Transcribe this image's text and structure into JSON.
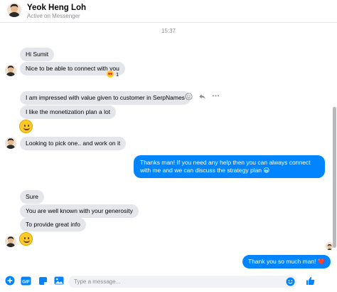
{
  "header": {
    "name": "Yeok Heng Loh",
    "status": "Active on Messenger"
  },
  "timestamp": "15:37",
  "messages": {
    "m1": "Hi Sumit",
    "m2": "Nice to be able to connect with you",
    "m2_reaction_count": "1",
    "m3": "I am impressed with value given to customer in SerpNames",
    "m4": "I like the monetization plan a lot",
    "m5": "Looking to pick one.. and work on it",
    "m6": "Thanks man! If you need any help then you can always connect with me and we can discuss the strategy plan 😀",
    "m7": "Sure",
    "m8": "You are well known with your generosity",
    "m9": "To provide great info",
    "m10": "Thank you so much man! ❤️"
  },
  "composer": {
    "placeholder": "Type a message..."
  },
  "colors": {
    "accent": "#0084ff",
    "incoming_bubble": "#e4e6eb",
    "heart": "#e0245e"
  },
  "icons": [
    "plus-icon",
    "gif-icon",
    "sticker-icon",
    "image-icon",
    "emoji-icon",
    "like-icon",
    "react-icon",
    "reply-icon",
    "more-icon"
  ]
}
